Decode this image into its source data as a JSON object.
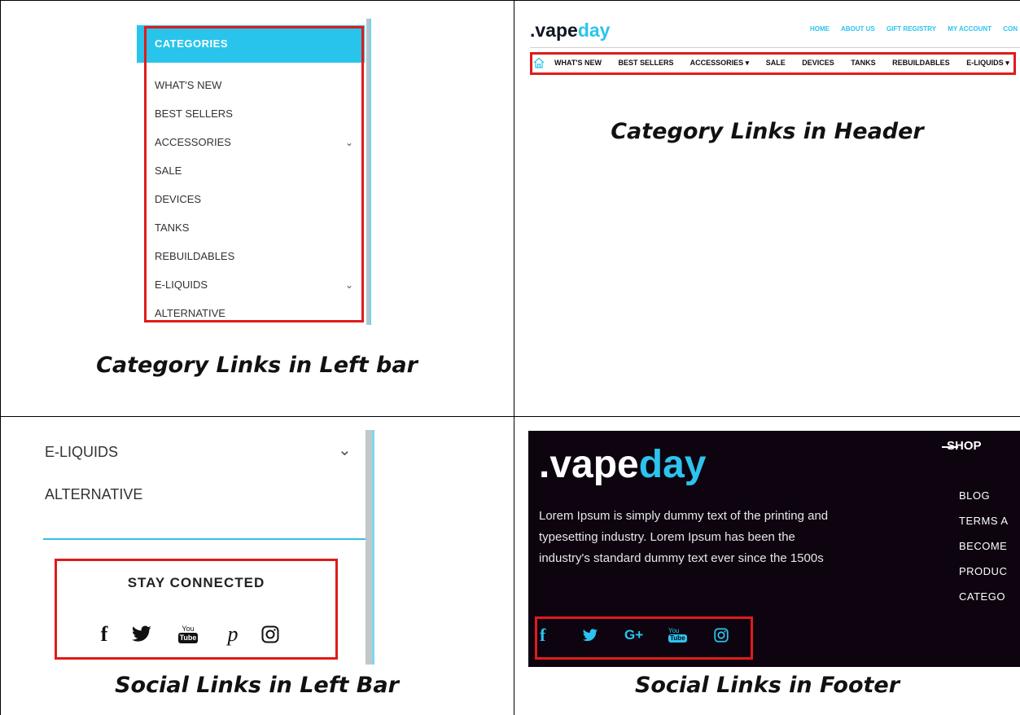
{
  "cells": {
    "left_bar_categories": {
      "header": "CATEGORIES",
      "items": [
        {
          "label": "WHAT'S NEW",
          "has_submenu": false
        },
        {
          "label": "BEST SELLERS",
          "has_submenu": false
        },
        {
          "label": "ACCESSORIES",
          "has_submenu": true
        },
        {
          "label": "SALE",
          "has_submenu": false
        },
        {
          "label": "DEVICES",
          "has_submenu": false
        },
        {
          "label": "TANKS",
          "has_submenu": false
        },
        {
          "label": "REBUILDABLES",
          "has_submenu": false
        },
        {
          "label": "E-LIQUIDS",
          "has_submenu": true
        },
        {
          "label": "ALTERNATIVE",
          "has_submenu": false
        }
      ],
      "caption": "Category Links in Left bar"
    },
    "header_categories": {
      "logo_part1": ".vape",
      "logo_part2": "day",
      "top_nav": [
        "HOME",
        "ABOUT US",
        "GIFT REGISTRY",
        "MY ACCOUNT",
        "CON"
      ],
      "nav_items": [
        "WHAT'S NEW",
        "BEST SELLERS",
        "ACCESSORIES ▾",
        "SALE",
        "DEVICES",
        "TANKS",
        "REBUILDABLES",
        "E-LIQUIDS ▾"
      ],
      "caption": "Category Links in Header"
    },
    "left_bar_social": {
      "items": [
        "E-LIQUIDS",
        "ALTERNATIVE"
      ],
      "stay_connected": "STAY CONNECTED",
      "icons": [
        "facebook-icon",
        "twitter-icon",
        "youtube-icon",
        "pinterest-icon",
        "instagram-icon"
      ],
      "youtube_top": "You",
      "youtube_bottom": "Tube",
      "caption": "Social Links in Left Bar"
    },
    "footer_social": {
      "logo_part1": ".vape",
      "logo_part2": "day",
      "description": "Lorem Ipsum is simply dummy text of the printing and typesetting industry. Lorem Ipsum has been the industry's standard dummy text ever since the 1500s",
      "shop_heading": "SHOP",
      "links": [
        "BLOG",
        "TERMS A",
        "BECOME",
        "PRODUC",
        "CATEGO"
      ],
      "icons": [
        "facebook-icon",
        "twitter-icon",
        "google-plus-icon",
        "youtube-icon",
        "instagram-icon"
      ],
      "youtube_top": "You",
      "youtube_bottom": "Tube",
      "caption": "Social Links in Footer"
    }
  },
  "colors": {
    "accent": "#2cc3ee",
    "highlight_box": "#e01b1b",
    "footer_bg": "#0d0410"
  }
}
